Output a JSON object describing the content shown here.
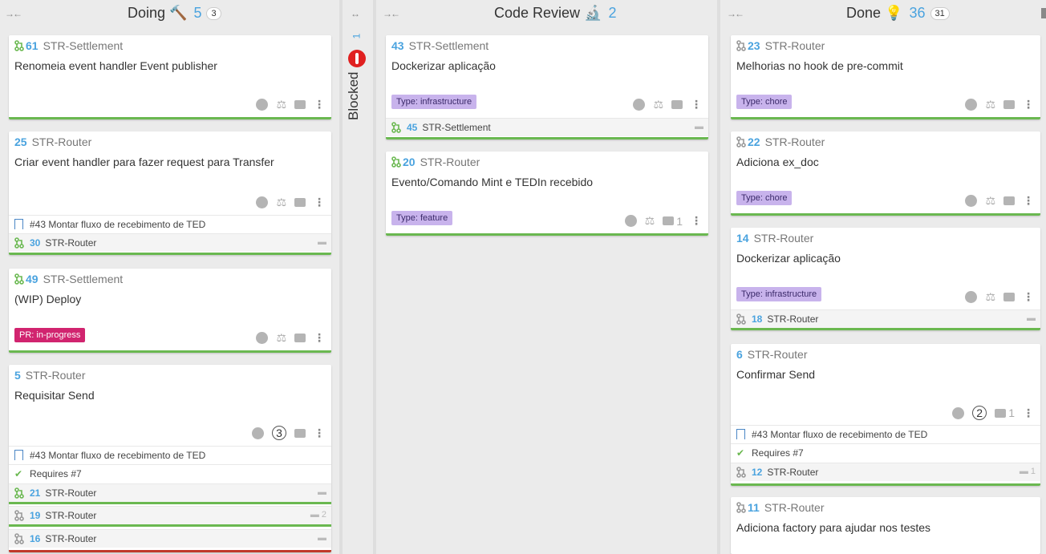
{
  "columns": {
    "doing": {
      "title": "Doing",
      "emoji": "🔨",
      "count": "5",
      "badge": "3"
    },
    "blocked": {
      "title": "Blocked",
      "count": "1"
    },
    "review": {
      "title": "Code Review",
      "emoji": "🔬",
      "count": "2"
    },
    "done": {
      "title": "Done",
      "emoji": "💡",
      "count": "36",
      "badge": "31"
    }
  },
  "doing_cards": [
    {
      "num": "61",
      "repo": "STR-Settlement",
      "title": "Renomeia event handler Event publisher"
    },
    {
      "num": "25",
      "repo": "STR-Router",
      "title": "Criar event handler para fazer request para Transfer",
      "issue": "#43 Montar fluxo de recebimento de TED",
      "linked_num": "30",
      "linked_repo": "STR-Router"
    },
    {
      "num": "49",
      "repo": "STR-Settlement",
      "title": "(WIP) Deploy",
      "label": "PR: in-progress"
    },
    {
      "num": "5",
      "repo": "STR-Router",
      "title": "Requisitar Send",
      "reviews": "3",
      "issue": "#43 Montar fluxo de recebimento de TED",
      "requires": "Requires #7",
      "linked": [
        {
          "num": "21",
          "repo": "STR-Router",
          "comments": ""
        },
        {
          "num": "19",
          "repo": "STR-Router",
          "comments": "2"
        },
        {
          "num": "16",
          "repo": "STR-Router",
          "comments": ""
        }
      ]
    }
  ],
  "review_cards": [
    {
      "num": "43",
      "repo": "STR-Settlement",
      "title": "Dockerizar aplicação",
      "label": "Type: infrastructure",
      "linked_num": "45",
      "linked_repo": "STR-Settlement"
    },
    {
      "num": "20",
      "repo": "STR-Router",
      "title": "Evento/Comando Mint e TEDIn recebido",
      "label": "Type: feature",
      "comments": "1"
    }
  ],
  "done_cards": [
    {
      "num": "23",
      "repo": "STR-Router",
      "title": "Melhorias no hook de pre-commit",
      "label": "Type: chore"
    },
    {
      "num": "22",
      "repo": "STR-Router",
      "title": "Adiciona ex_doc",
      "label": "Type: chore"
    },
    {
      "num": "14",
      "repo": "STR-Router",
      "title": "Dockerizar aplicação",
      "label": "Type: infrastructure",
      "linked_num": "18",
      "linked_repo": "STR-Router"
    },
    {
      "num": "6",
      "repo": "STR-Router",
      "title": "Confirmar Send",
      "reviews": "2",
      "comments": "1",
      "issue": "#43 Montar fluxo de recebimento de TED",
      "requires": "Requires #7",
      "linked_num": "12",
      "linked_repo": "STR-Router",
      "linked_comments": "1"
    },
    {
      "num": "11",
      "repo": "STR-Router",
      "title": "Adiciona factory para ajudar nos testes"
    }
  ],
  "colors": {
    "accent": "#4aa3df",
    "green": "#6ab850",
    "red": "#c0392b",
    "purple_label": "#c8b3ec",
    "pink_label": "#d1246f"
  }
}
